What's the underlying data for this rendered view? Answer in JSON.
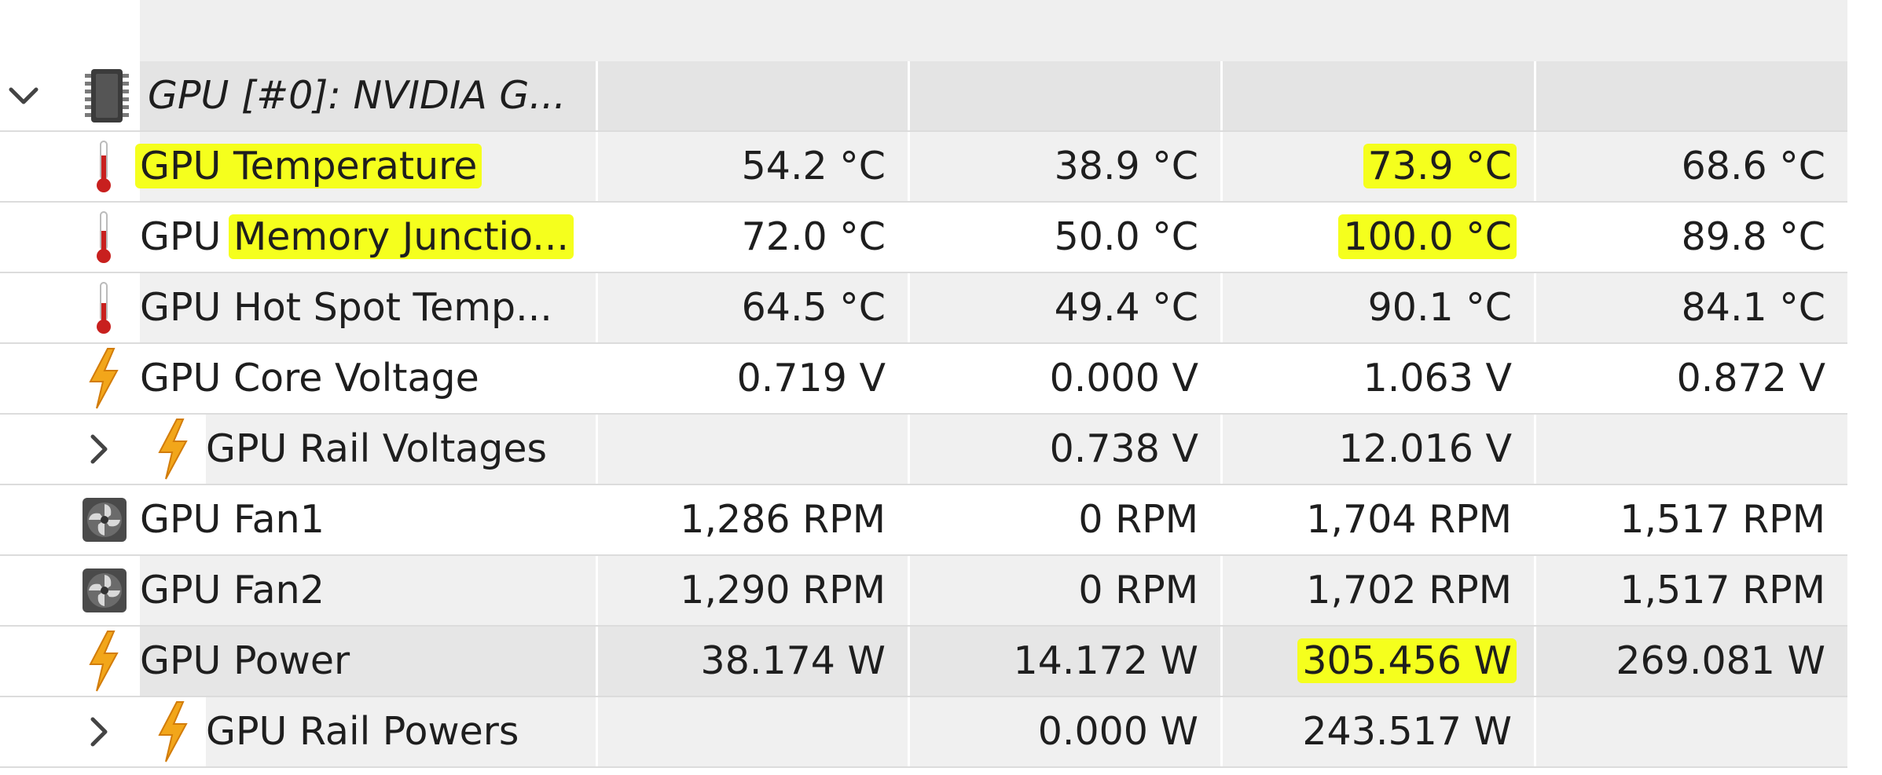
{
  "group": {
    "label": "GPU [#0]: NVIDIA G...",
    "icon": "chip-icon",
    "expanded": true
  },
  "sensors": [
    {
      "name_a": "GPU Temperature",
      "name_b": "",
      "icon": "thermometer-icon",
      "current": "54.2 °C",
      "min": "38.9 °C",
      "max": "73.9 °C",
      "avg": "68.6 °C"
    },
    {
      "name_a": "GPU ",
      "name_b": "Memory Junctio...",
      "icon": "thermometer-icon",
      "current": "72.0 °C",
      "min": "50.0 °C",
      "max": "100.0 °C",
      "avg": "89.8 °C"
    },
    {
      "name_a": "GPU Hot Spot Temp...",
      "name_b": "",
      "icon": "thermometer-icon",
      "current": "64.5 °C",
      "min": "49.4 °C",
      "max": "90.1 °C",
      "avg": "84.1 °C"
    },
    {
      "name_a": "GPU Core Voltage",
      "name_b": "",
      "icon": "lightning-icon",
      "current": "0.719 V",
      "min": "0.000 V",
      "max": "1.063 V",
      "avg": "0.872 V"
    },
    {
      "name_a": "GPU Rail Voltages",
      "name_b": "",
      "icon": "lightning-icon",
      "current": "",
      "min": "0.738 V",
      "max": "12.016 V",
      "avg": ""
    },
    {
      "name_a": "GPU Fan1",
      "name_b": "",
      "icon": "fan-icon",
      "current": "1,286 RPM",
      "min": "0 RPM",
      "max": "1,704 RPM",
      "avg": "1,517 RPM"
    },
    {
      "name_a": "GPU Fan2",
      "name_b": "",
      "icon": "fan-icon",
      "current": "1,290 RPM",
      "min": "0 RPM",
      "max": "1,702 RPM",
      "avg": "1,517 RPM"
    },
    {
      "name_a": "GPU Power",
      "name_b": "",
      "icon": "lightning-icon",
      "current": "38.174 W",
      "min": "14.172 W",
      "max": "305.456 W",
      "avg": "269.081 W"
    },
    {
      "name_a": "GPU Rail Powers",
      "name_b": "",
      "icon": "lightning-icon",
      "current": "",
      "min": "0.000 W",
      "max": "243.517 W",
      "avg": ""
    }
  ],
  "colors": {
    "highlight": "#f5ff1d",
    "thermometer": "#c8201e",
    "lightning": "#f2a61a"
  }
}
